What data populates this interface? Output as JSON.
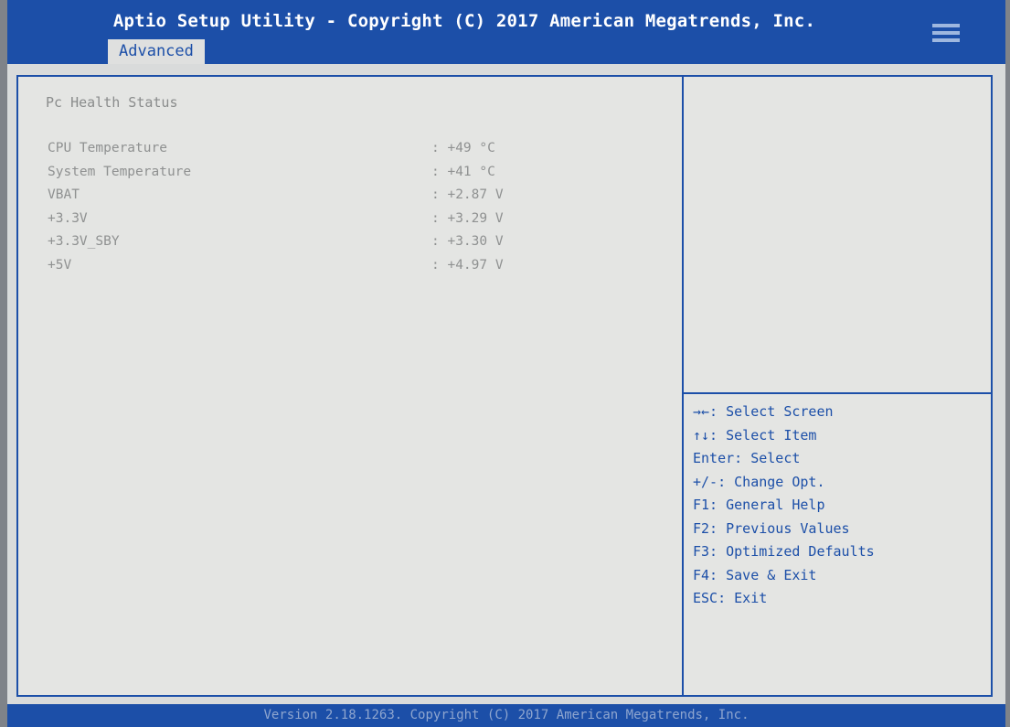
{
  "header": {
    "title": "Aptio Setup Utility - Copyright (C) 2017 American Megatrends, Inc.",
    "tab_label": "Advanced"
  },
  "main": {
    "section_title": "Pc Health Status",
    "rows": [
      {
        "label": "CPU Temperature",
        "value": ": +49 °C"
      },
      {
        "label": "System Temperature",
        "value": ": +41 °C"
      },
      {
        "label": "VBAT",
        "value": ": +2.87 V"
      },
      {
        "label": "+3.3V",
        "value": ": +3.29 V"
      },
      {
        "label": "+3.3V_SBY",
        "value": ": +3.30 V"
      },
      {
        "label": "+5V",
        "value": ": +4.97 V"
      }
    ]
  },
  "help": {
    "lines": [
      "→←: Select Screen",
      "↑↓: Select Item",
      "Enter: Select",
      "+/-: Change Opt.",
      "F1: General Help",
      "F2: Previous Values",
      "F3: Optimized Defaults",
      "F4: Save & Exit",
      "ESC: Exit"
    ]
  },
  "footer": {
    "text": "Version 2.18.1263. Copyright (C) 2017 American Megatrends, Inc."
  },
  "colors": {
    "accent": "#1c4fa8",
    "background": "#e4e5e3",
    "dim_text": "#8f9191"
  },
  "icons": {
    "menu": "hamburger-icon"
  }
}
